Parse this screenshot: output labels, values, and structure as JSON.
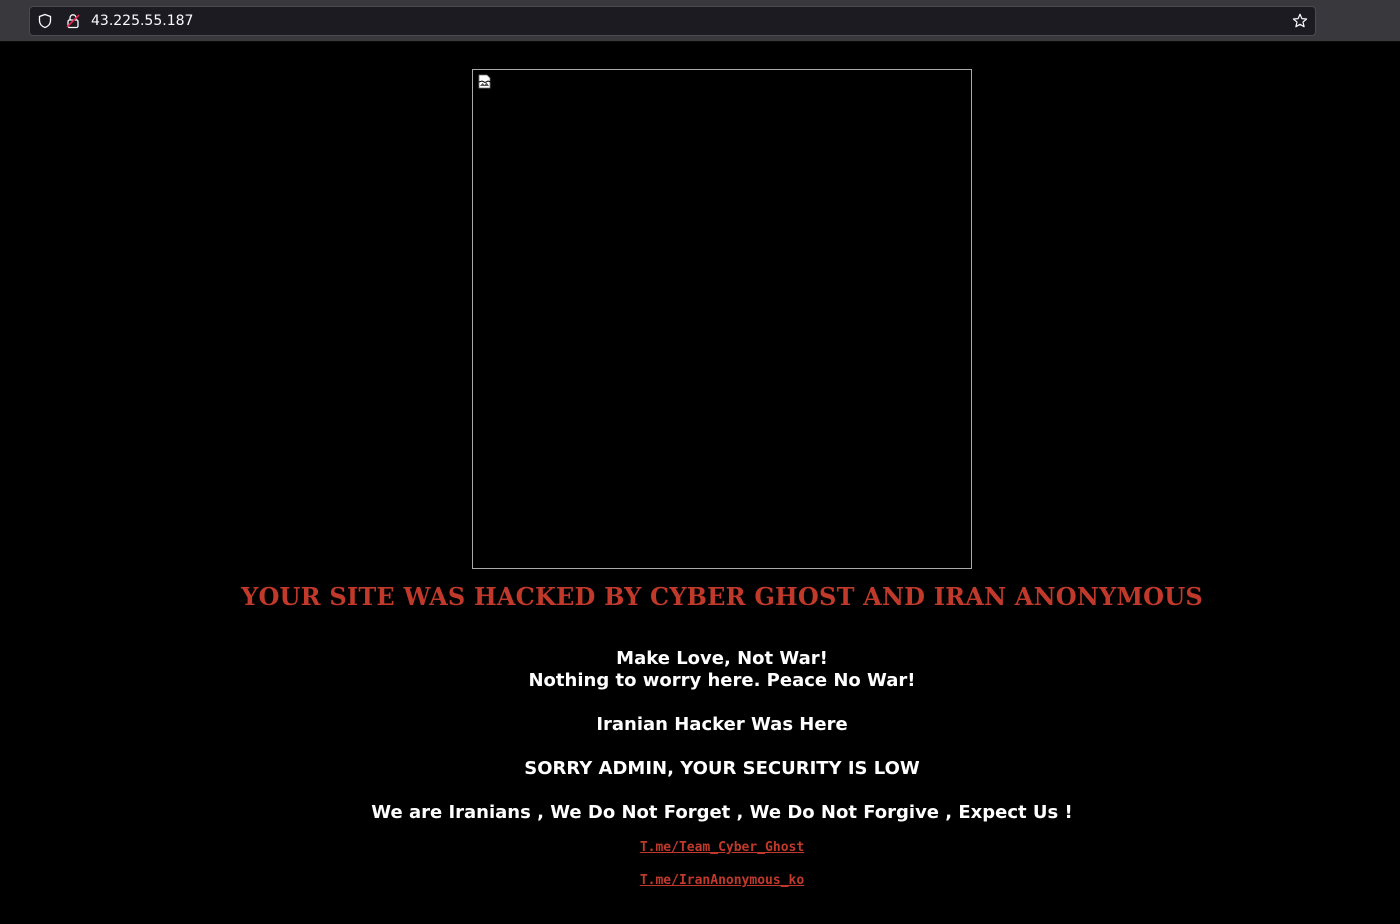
{
  "browser": {
    "url": "43.225.55.187"
  },
  "icons": {
    "shield": "shield-icon",
    "lock": "lock-insecure-icon",
    "star": "bookmark-star-icon",
    "broken_image": "broken-image-icon"
  },
  "colors": {
    "accent": "#c0392b",
    "background": "#000000"
  },
  "main": {
    "headline": "YOUR SITE WAS HACKED BY CYBER GHOST AND IRAN ANONYMOUS",
    "line1": "Make Love, Not War!",
    "line2": "Nothing to worry here. Peace No War!",
    "line3": "Iranian Hacker Was Here",
    "line4": "SORRY ADMIN, YOUR SECURITY IS LOW",
    "line5": "We are Iranians , We Do Not Forget , We Do Not Forgive , Expect Us !",
    "link1": "T.me/Team_Cyber_Ghost",
    "link2": "T.me/IranAnonymous_ko"
  }
}
